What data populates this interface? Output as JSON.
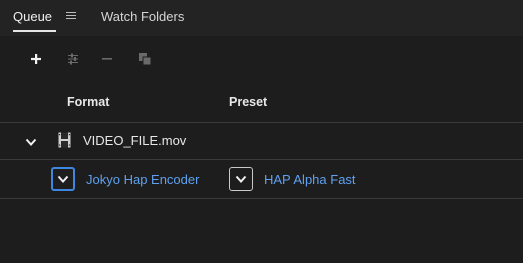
{
  "tabs": {
    "queue_label": "Queue",
    "watch_folders_label": "Watch Folders"
  },
  "toolbar": {
    "icons": [
      "add-icon",
      "queue-settings-icon",
      "remove-icon",
      "duplicate-icon"
    ]
  },
  "columns": {
    "format": "Format",
    "preset": "Preset"
  },
  "queue_item": {
    "file_name": "VIDEO_FILE.mov",
    "output": {
      "format": "Jokyo Hap Encoder",
      "preset": "HAP Alpha Fast"
    }
  },
  "colors": {
    "background": "#1d1d1d",
    "link_blue": "#5ea1f0",
    "focus_blue": "#3f86e0"
  }
}
